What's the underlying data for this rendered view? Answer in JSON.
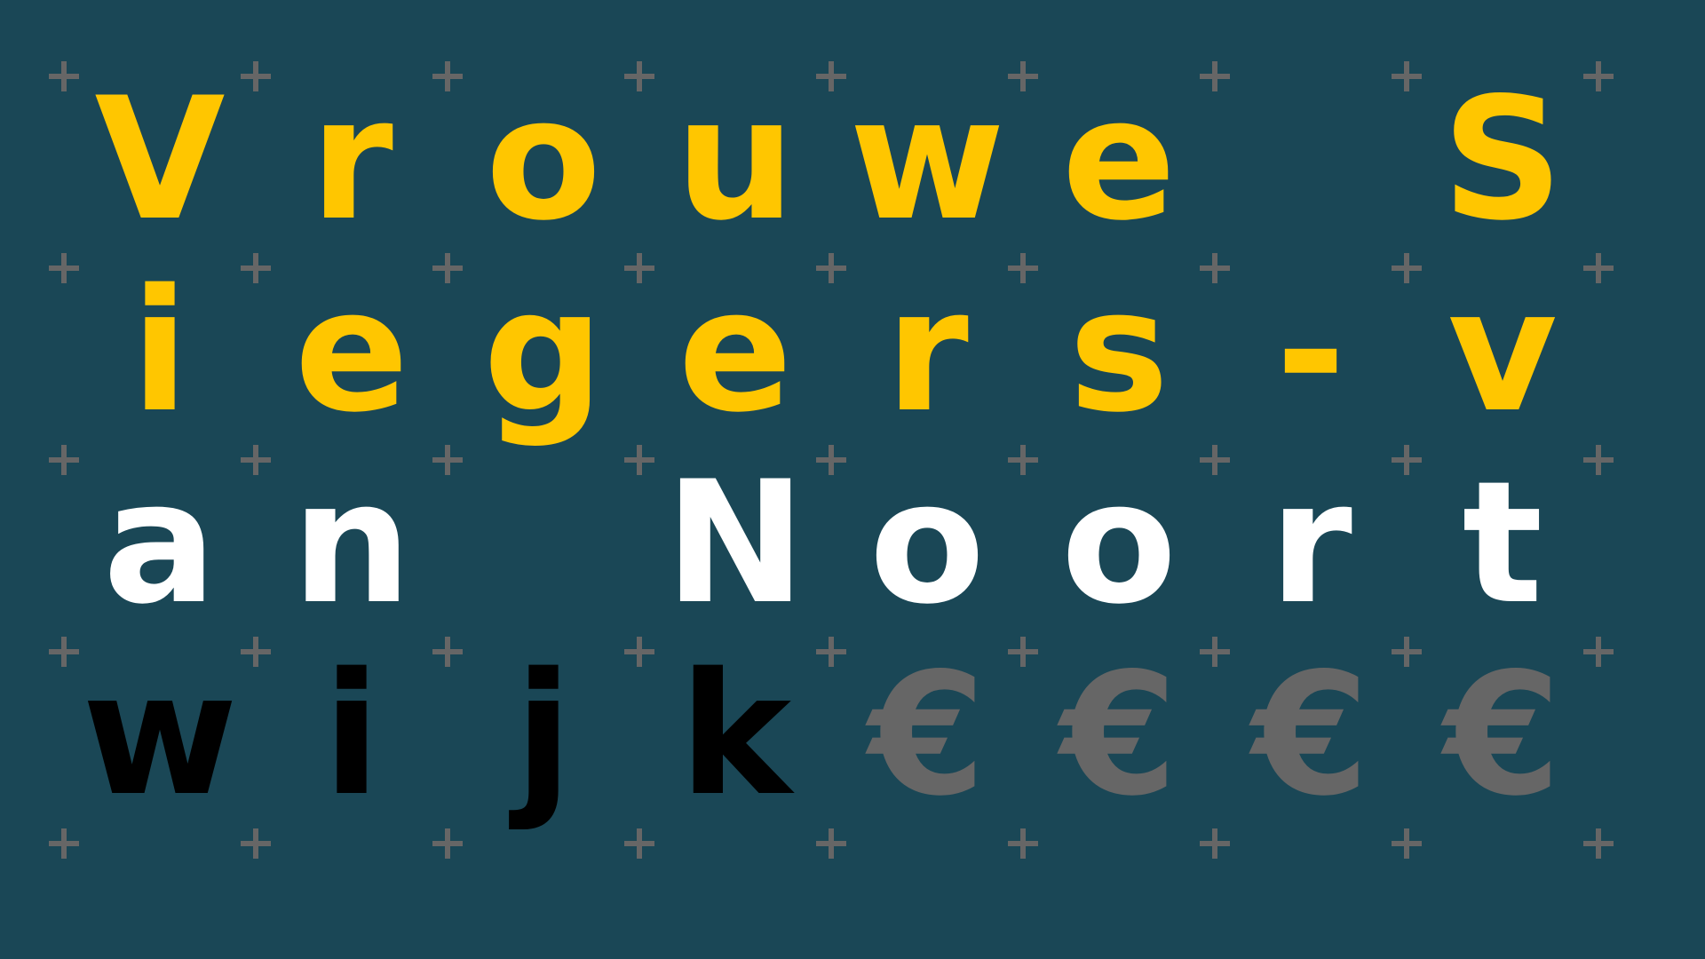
{
  "colors": {
    "background": "#1a4756",
    "yellow": "#ffc600",
    "white": "#ffffff",
    "black": "#000000",
    "gray": "#666666"
  },
  "grid": {
    "rows": [
      {
        "cells": [
          {
            "char": "V",
            "color": "#ffc600"
          },
          {
            "char": "r",
            "color": "#ffc600"
          },
          {
            "char": "o",
            "color": "#ffc600"
          },
          {
            "char": "u",
            "color": "#ffc600"
          },
          {
            "char": "w",
            "color": "#ffc600"
          },
          {
            "char": "e",
            "color": "#ffc600"
          },
          {
            "char": "",
            "color": "#ffc600"
          },
          {
            "char": "S",
            "color": "#ffc600"
          }
        ]
      },
      {
        "cells": [
          {
            "char": "i",
            "color": "#ffc600"
          },
          {
            "char": "e",
            "color": "#ffc600"
          },
          {
            "char": "g",
            "color": "#ffc600"
          },
          {
            "char": "e",
            "color": "#ffc600"
          },
          {
            "char": "r",
            "color": "#ffc600"
          },
          {
            "char": "s",
            "color": "#ffc600"
          },
          {
            "char": "-",
            "color": "#ffc600"
          },
          {
            "char": "v",
            "color": "#ffc600"
          }
        ]
      },
      {
        "cells": [
          {
            "char": "a",
            "color": "#ffffff"
          },
          {
            "char": "n",
            "color": "#ffffff"
          },
          {
            "char": "",
            "color": "#ffffff"
          },
          {
            "char": "N",
            "color": "#ffffff"
          },
          {
            "char": "o",
            "color": "#ffffff"
          },
          {
            "char": "o",
            "color": "#ffffff"
          },
          {
            "char": "r",
            "color": "#ffffff"
          },
          {
            "char": "t",
            "color": "#ffffff"
          }
        ]
      },
      {
        "cells": [
          {
            "char": "w",
            "color": "#000000"
          },
          {
            "char": "i",
            "color": "#000000"
          },
          {
            "char": "j",
            "color": "#000000"
          },
          {
            "char": "k",
            "color": "#000000"
          },
          {
            "char": "€",
            "color": "#666666"
          },
          {
            "char": "€",
            "color": "#666666"
          },
          {
            "char": "€",
            "color": "#666666"
          },
          {
            "char": "€",
            "color": "#666666"
          }
        ]
      }
    ]
  }
}
